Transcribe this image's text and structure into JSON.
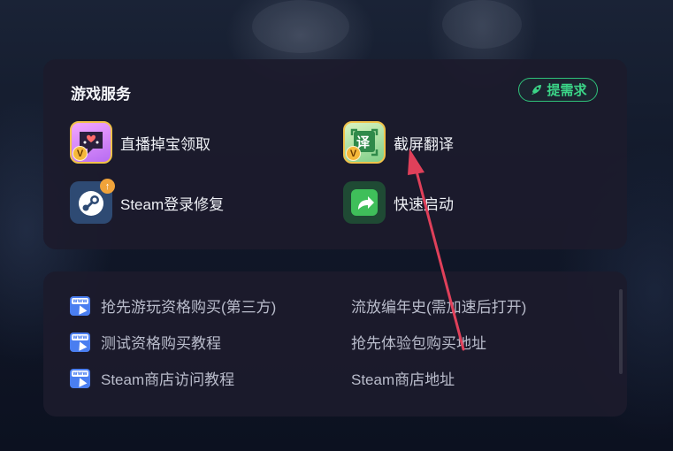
{
  "services": {
    "title": "游戏服务",
    "request_label": "提需求",
    "items": [
      {
        "label": "直播掉宝领取",
        "icon": "live-gift-icon",
        "badge": "V"
      },
      {
        "label": "截屏翻译",
        "icon": "screen-translate-icon",
        "badge": "V",
        "icon_text": "译"
      },
      {
        "label": "Steam登录修复",
        "icon": "steam-icon"
      },
      {
        "label": "快速启动",
        "icon": "quick-launch-icon"
      }
    ]
  },
  "links": {
    "www_text": "www",
    "items": [
      {
        "label": "抢先游玩资格购买(第三方)",
        "icon": "www-link-icon"
      },
      {
        "label": "测试资格购买教程",
        "icon": "www-link-icon"
      },
      {
        "label": "Steam商店访问教程",
        "icon": "www-link-icon"
      },
      {
        "label": "流放编年史(需加速后打开)"
      },
      {
        "label": "抢先体验包购买地址"
      },
      {
        "label": "Steam商店地址"
      }
    ]
  },
  "colors": {
    "accent_green": "#2fc27a",
    "annotation_arrow": "#e0405a",
    "link_icon_blue": "#4a7ef0"
  }
}
